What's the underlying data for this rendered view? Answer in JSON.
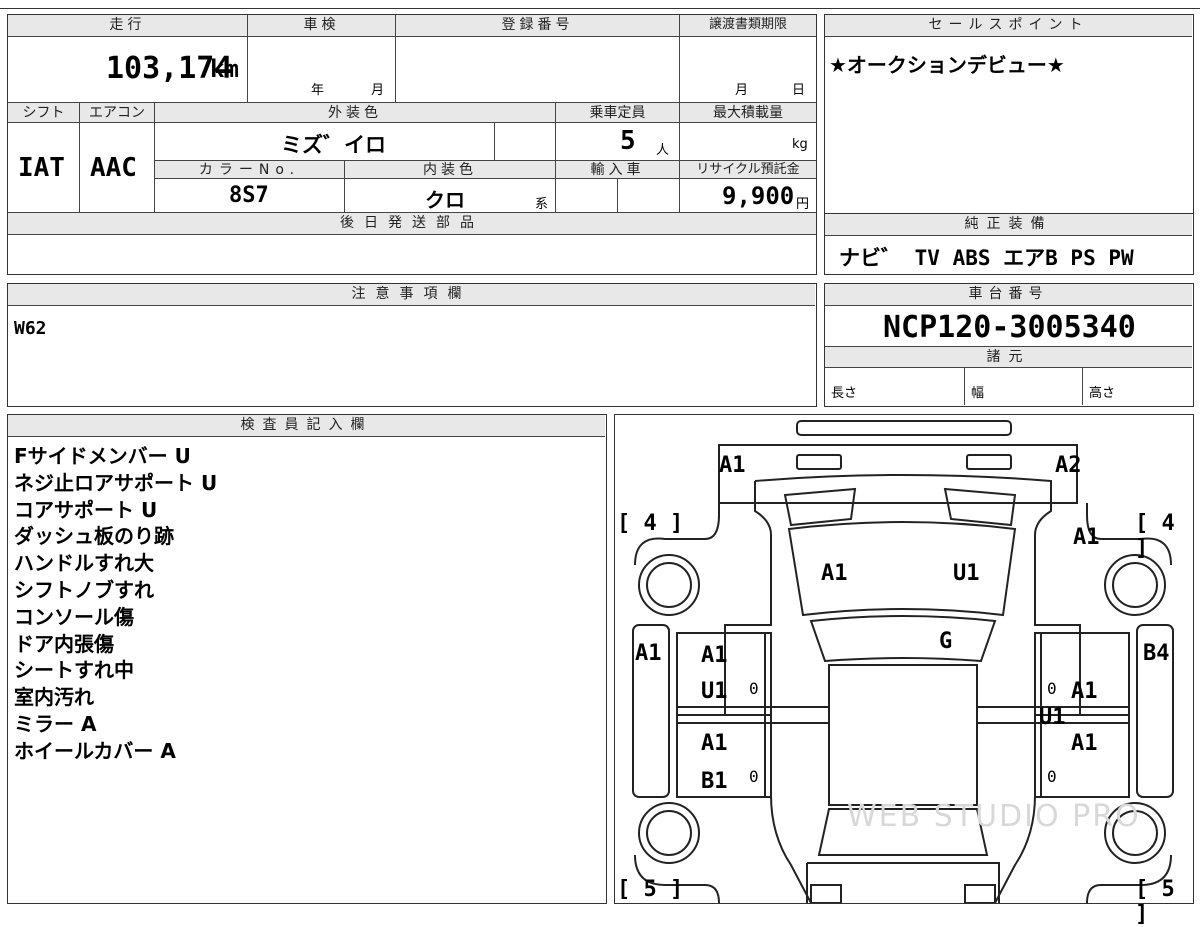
{
  "spec": {
    "mileage_label": "走行",
    "mileage_value": "103,174",
    "mileage_unit": "km",
    "inspection_label": "車検",
    "inspection_year": "年",
    "inspection_month": "月",
    "registration_label": "登録番号",
    "transfer_label": "譲渡書類期限",
    "transfer_month": "月",
    "transfer_day": "日",
    "shift_label": "シフト",
    "shift_value": "IAT",
    "ac_label": "エアコン",
    "ac_value": "AAC",
    "exterior_color_label": "外装色",
    "exterior_color_value": "ミズ゛イロ",
    "capacity_label": "乗車定員",
    "capacity_value": "5",
    "capacity_unit": "人",
    "max_load_label": "最大積載量",
    "max_load_unit": "kg",
    "color_no_label": "カラーNo.",
    "color_no_value": "8S7",
    "interior_color_label": "内装色",
    "interior_color_value": "クロ",
    "interior_color_suffix": "系",
    "import_label": "輸入車",
    "recycle_label": "リサイクル預託金",
    "recycle_value": "9,900",
    "recycle_unit": "円",
    "later_parts_label": "後日発送部品"
  },
  "sales": {
    "label": "セールスポイント",
    "text": "★オークションデビュー★"
  },
  "equipment": {
    "label": "純正装備",
    "items": "ナビ゛ TV ABS エアB PS PW"
  },
  "caution": {
    "label": "注意事項欄",
    "text": "W62"
  },
  "chassis": {
    "label": "車台番号",
    "value": "NCP120-3005340",
    "dims_label": "諸元",
    "length_label": "長さ",
    "width_label": "幅",
    "height_label": "高さ"
  },
  "inspector": {
    "label": "検査員記入欄",
    "notes": [
      "Fサイドメンバー U",
      "ネジ止ロアサポート U",
      "コアサポート U",
      "ダッシュ板のり跡",
      "ハンドルすれ大",
      "シフトノブすれ",
      "コンソール傷",
      "ドア内張傷",
      "シートすれ中",
      "室内汚れ",
      "ミラー A",
      "ホイールカバー A"
    ]
  },
  "diagram": {
    "front_left": "A1",
    "front_right": "A2",
    "tire_fl": "[ 4 ]",
    "tire_fr": "[ 4 ]",
    "tire_rl": "[ 5 ]",
    "tire_rr": "[ 5 ]",
    "fender_fr": "A1",
    "hood_left": "A1",
    "hood_right": "U1",
    "windshield": "G",
    "left_side": "A1",
    "right_side": "B4",
    "ld_front_1": "A1",
    "ld_front_2": "U1",
    "ld_rear_1": "A1",
    "ld_rear_2": "B1",
    "rd_front_1": "A1",
    "rd_front_2": "U1",
    "rd_rear_1": "A1",
    "zero_mark": "0",
    "watermark": "WEB STUDIO PRO"
  }
}
